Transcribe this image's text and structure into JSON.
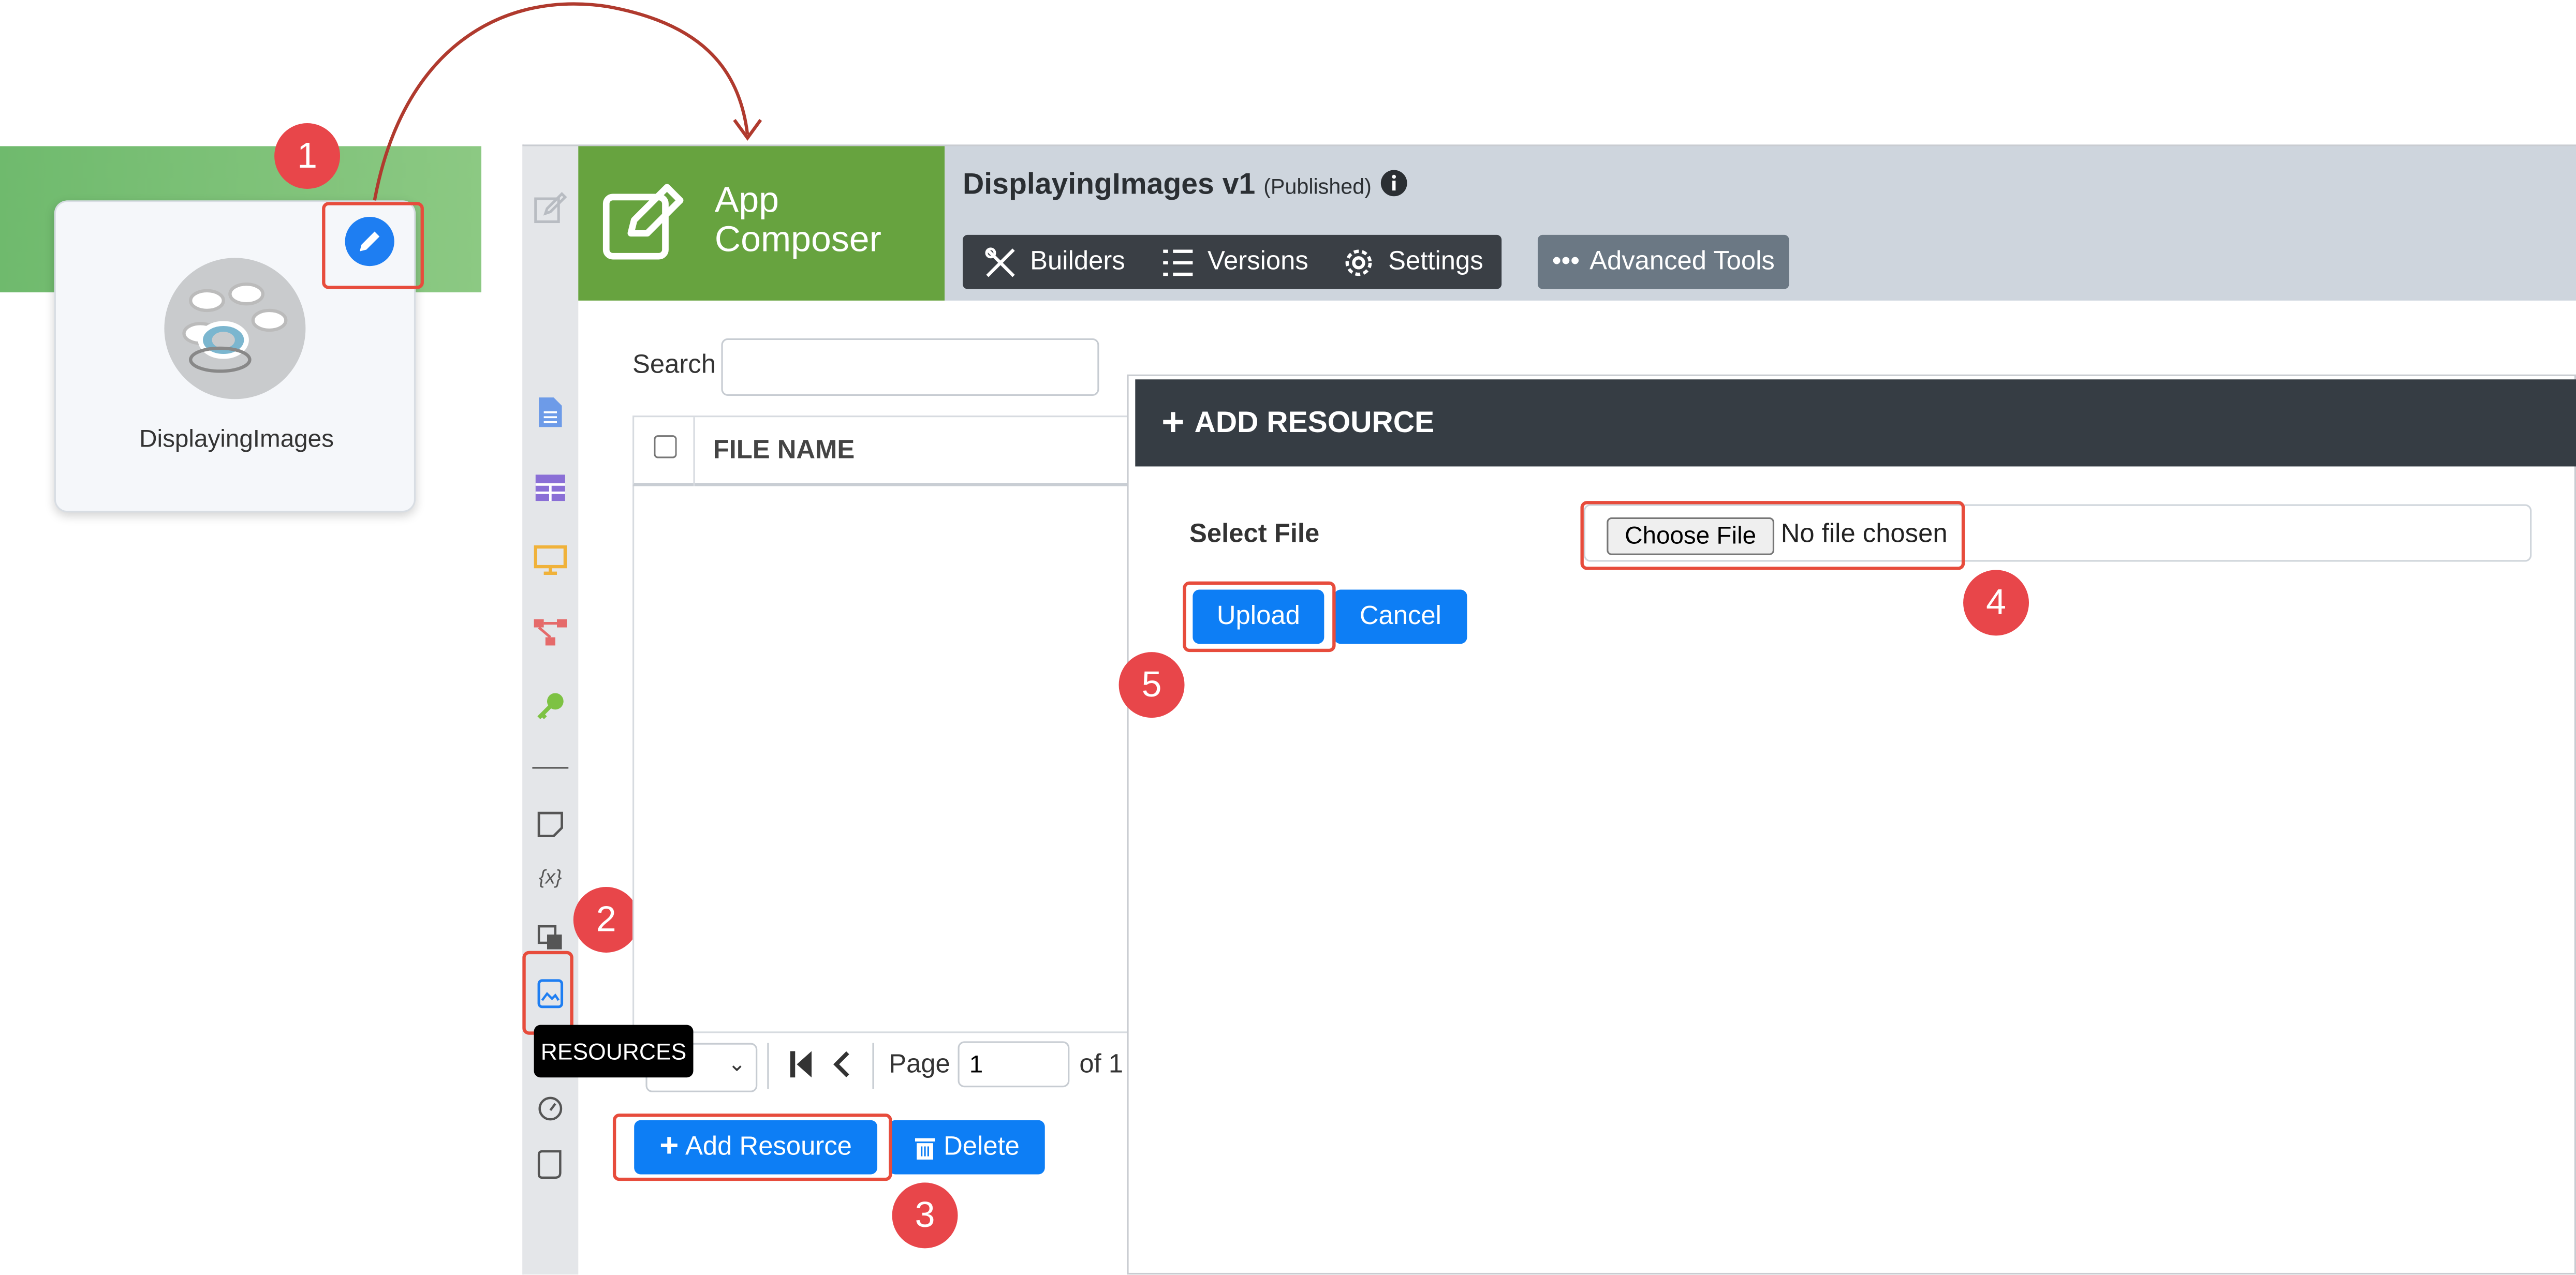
{
  "app_card": {
    "name": "DisplayingImages"
  },
  "brand": {
    "line1": "App",
    "line2": "Composer"
  },
  "app": {
    "title": "DisplayingImages v1",
    "status": "(Published)"
  },
  "toolbar": {
    "builders": "Builders",
    "versions": "Versions",
    "settings": "Settings",
    "advanced": "Advanced Tools"
  },
  "sidebar": {
    "tooltip": "RESOURCES"
  },
  "list": {
    "search_label": "Search",
    "column_file_name": "FILE NAME",
    "page_label": "Page",
    "page_value": "1",
    "page_of": "of 1",
    "add_resource": "Add Resource",
    "delete": "Delete"
  },
  "modal": {
    "title": "ADD RESOURCE",
    "select_file_label": "Select File",
    "choose_file": "Choose File",
    "no_file": "No file chosen",
    "upload": "Upload",
    "cancel": "Cancel"
  },
  "steps": [
    "1",
    "2",
    "3",
    "4",
    "5"
  ],
  "colors": {
    "accent_blue": "#0d7ef5",
    "brand_green": "#67a33f",
    "step_red": "#e8464a",
    "header_dark": "#363d44"
  }
}
